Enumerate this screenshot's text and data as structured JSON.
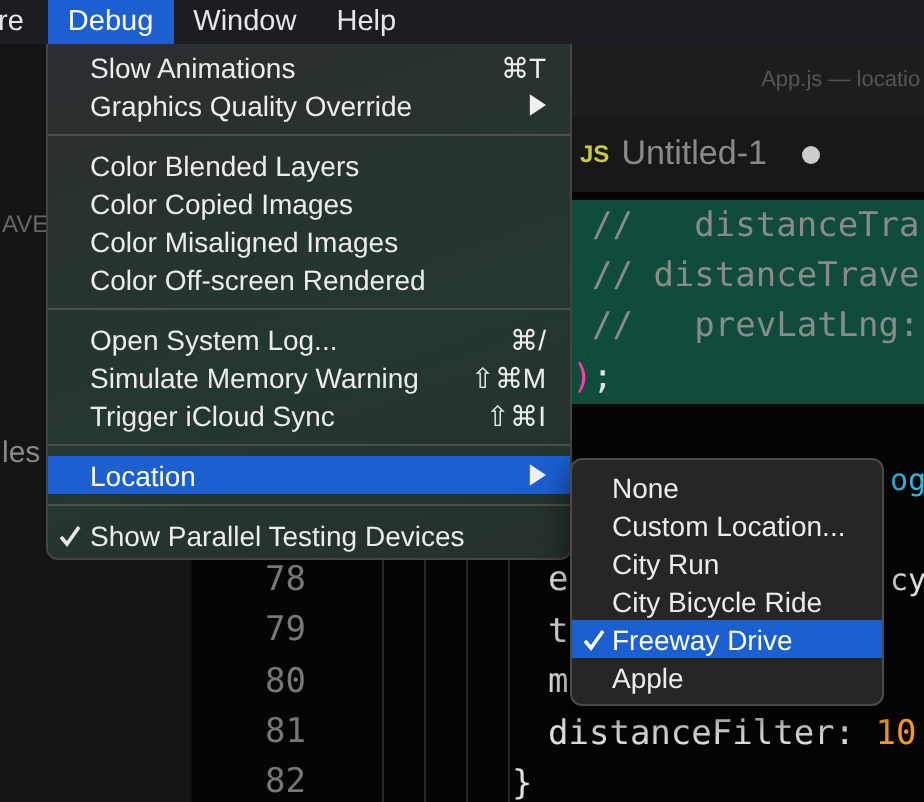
{
  "menu_bar": {
    "items": [
      {
        "label": "re",
        "selected": false
      },
      {
        "label": "Debug",
        "selected": true
      },
      {
        "label": "Window",
        "selected": false
      },
      {
        "label": "Help",
        "selected": false
      }
    ]
  },
  "sidebar": {
    "texts": [
      "AVE",
      "les"
    ]
  },
  "editor": {
    "window_title": "App.js — locatio",
    "tab": {
      "label": "Untitled-1",
      "badge": "JS",
      "modified": true
    },
    "lines": [
      {
        "highlighted": true,
        "tokens": [
          {
            "text": "//   distanceTra",
            "kind": "comment"
          }
        ]
      },
      {
        "highlighted": true,
        "tokens": [
          {
            "text": "// distanceTrave",
            "kind": "comment"
          }
        ]
      },
      {
        "highlighted": true,
        "tokens": [
          {
            "text": "//   prevLatLng:",
            "kind": "comment"
          }
        ]
      },
      {
        "highlighted": true,
        "tokens": [
          {
            "text": ")",
            "kind": "punct"
          },
          {
            "text": ";",
            "kind": "plain"
          }
        ]
      },
      {
        "highlighted": false
      },
      {
        "highlighted": false,
        "tokens": [
          {
            "text": "og",
            "kind": "func"
          }
        ]
      },
      {
        "highlighted": false
      },
      {
        "number": "78",
        "highlighted": false,
        "tokens": [
          {
            "text": "e",
            "kind": "plain"
          },
          {
            "text": "cy",
            "kind": "plain"
          }
        ]
      },
      {
        "number": "79",
        "highlighted": false,
        "tokens": [
          {
            "text": "t",
            "kind": "plain"
          }
        ]
      },
      {
        "number": "80",
        "highlighted": false,
        "tokens": [
          {
            "text": "m",
            "kind": "plain"
          }
        ]
      },
      {
        "number": "81",
        "highlighted": false,
        "tokens": [
          {
            "text": "distanceFilter: ",
            "kind": "plain"
          },
          {
            "text": "10",
            "kind": "number"
          }
        ]
      },
      {
        "number": "82",
        "highlighted": false,
        "tokens": [
          {
            "text": "}",
            "kind": "plain"
          }
        ]
      }
    ]
  },
  "debug_menu": {
    "items": [
      {
        "kind": "item",
        "label": "Slow Animations",
        "shortcut": "⌘T",
        "submenu": false,
        "checked": false,
        "selected": false
      },
      {
        "kind": "item",
        "label": "Graphics Quality Override",
        "submenu": true,
        "checked": false,
        "selected": false
      },
      {
        "kind": "separator"
      },
      {
        "kind": "item",
        "label": "Color Blended Layers",
        "submenu": false,
        "checked": false,
        "selected": false
      },
      {
        "kind": "item",
        "label": "Color Copied Images",
        "submenu": false,
        "checked": false,
        "selected": false
      },
      {
        "kind": "item",
        "label": "Color Misaligned Images",
        "submenu": false,
        "checked": false,
        "selected": false
      },
      {
        "kind": "item",
        "label": "Color Off-screen Rendered",
        "submenu": false,
        "checked": false,
        "selected": false
      },
      {
        "kind": "separator"
      },
      {
        "kind": "item",
        "label": "Open System Log...",
        "shortcut": "⌘/",
        "submenu": false,
        "checked": false,
        "selected": false
      },
      {
        "kind": "item",
        "label": "Simulate Memory Warning",
        "shortcut": "⇧⌘M",
        "submenu": false,
        "checked": false,
        "selected": false
      },
      {
        "kind": "item",
        "label": "Trigger iCloud Sync",
        "shortcut": "⇧⌘I",
        "submenu": false,
        "checked": false,
        "selected": false
      },
      {
        "kind": "separator"
      },
      {
        "kind": "item",
        "label": "Location",
        "submenu": true,
        "checked": false,
        "selected": true
      },
      {
        "kind": "separator"
      },
      {
        "kind": "item",
        "label": "Show Parallel Testing Devices",
        "submenu": false,
        "checked": true,
        "selected": false
      }
    ]
  },
  "location_submenu": {
    "items": [
      {
        "label": "None",
        "checked": false,
        "selected": false
      },
      {
        "label": "Custom Location...",
        "checked": false,
        "selected": false
      },
      {
        "label": "City Run",
        "checked": false,
        "selected": false
      },
      {
        "label": "City Bicycle Ride",
        "checked": false,
        "selected": false
      },
      {
        "label": "Freeway Drive",
        "checked": true,
        "selected": true
      },
      {
        "label": "Apple",
        "checked": false,
        "selected": false
      }
    ]
  }
}
